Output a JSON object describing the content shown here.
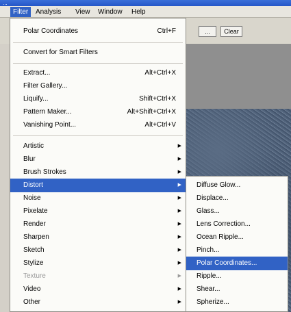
{
  "window": {
    "title": "..."
  },
  "menubar": [
    {
      "label": "Filter",
      "active": true
    },
    {
      "label": "Analysis"
    },
    {
      "label": "View"
    },
    {
      "label": "Window"
    },
    {
      "label": "Help"
    }
  ],
  "options_bar": {
    "button1": "...",
    "button2": "Clear"
  },
  "filter_menu": {
    "last_filter": {
      "label": "Polar Coordinates",
      "shortcut": "Ctrl+F"
    },
    "convert_smart": "Convert for Smart Filters",
    "group1": [
      {
        "label": "Extract...",
        "shortcut": "Alt+Ctrl+X"
      },
      {
        "label": "Filter Gallery...",
        "shortcut": ""
      },
      {
        "label": "Liquify...",
        "shortcut": "Shift+Ctrl+X"
      },
      {
        "label": "Pattern Maker...",
        "shortcut": "Alt+Shift+Ctrl+X"
      },
      {
        "label": "Vanishing Point...",
        "shortcut": "Alt+Ctrl+V"
      }
    ],
    "categories": [
      {
        "label": "Artistic"
      },
      {
        "label": "Blur"
      },
      {
        "label": "Brush Strokes"
      },
      {
        "label": "Distort",
        "highlighted": true
      },
      {
        "label": "Noise"
      },
      {
        "label": "Pixelate"
      },
      {
        "label": "Render"
      },
      {
        "label": "Sharpen"
      },
      {
        "label": "Sketch"
      },
      {
        "label": "Stylize"
      },
      {
        "label": "Texture",
        "disabled": true
      },
      {
        "label": "Video"
      },
      {
        "label": "Other"
      }
    ]
  },
  "distort_submenu": [
    {
      "label": "Diffuse Glow..."
    },
    {
      "label": "Displace..."
    },
    {
      "label": "Glass..."
    },
    {
      "label": "Lens Correction..."
    },
    {
      "label": "Ocean Ripple..."
    },
    {
      "label": "Pinch..."
    },
    {
      "label": "Polar Coordinates...",
      "highlighted": true
    },
    {
      "label": "Ripple..."
    },
    {
      "label": "Shear..."
    },
    {
      "label": "Spherize..."
    }
  ]
}
